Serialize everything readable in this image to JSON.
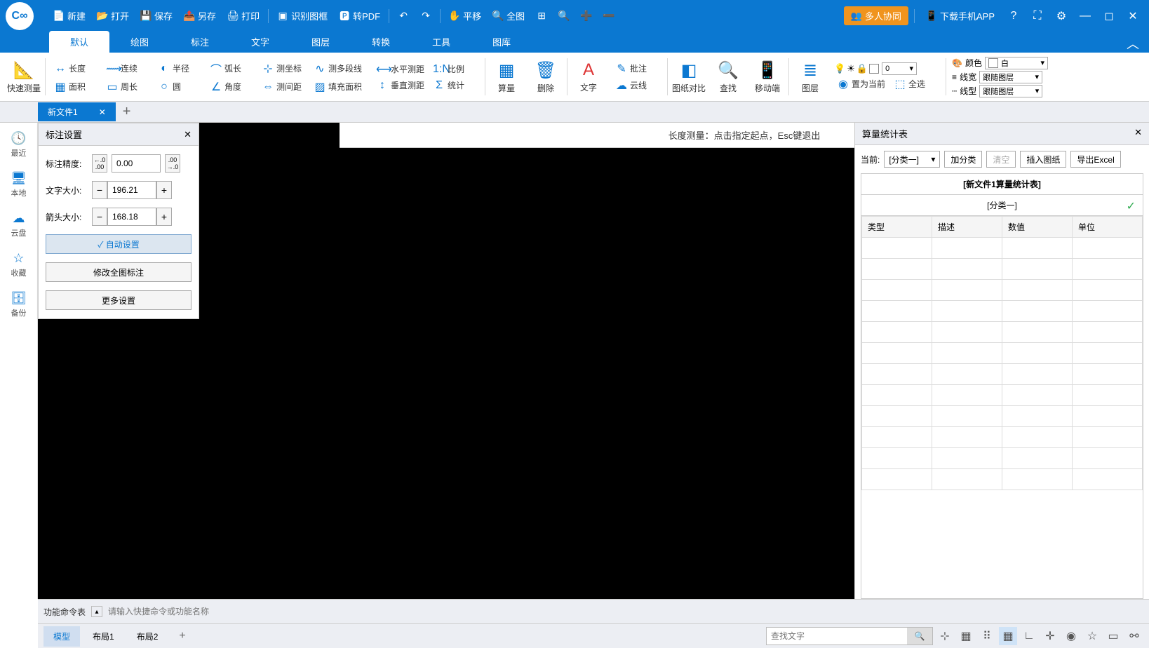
{
  "titlebar": {
    "new": "新建",
    "open": "打开",
    "save": "保存",
    "saveas": "另存",
    "print": "打印",
    "recognize": "识别图框",
    "topdf": "转PDF",
    "pan": "平移",
    "fullview": "全图",
    "collab": "多人协同",
    "download": "下载手机APP"
  },
  "menutabs": [
    "默认",
    "绘图",
    "标注",
    "文字",
    "图层",
    "转换",
    "工具",
    "图库"
  ],
  "ribbon": {
    "quick": "快速测量",
    "g1": {
      "len": "长度",
      "cont": "连续",
      "radius": "半径",
      "arc": "弧长",
      "coord": "测坐标",
      "multi": "测多段线",
      "area": "面积",
      "peri": "周长",
      "circle": "圆",
      "angle": "角度",
      "gap": "测间距",
      "fill": "填充面积"
    },
    "g2": {
      "horiz": "水平测距",
      "ratio": "比例",
      "vert": "垂直测距",
      "stat": "统计"
    },
    "g3": {
      "calc": "算量",
      "del": "删除"
    },
    "g4": {
      "text": "文字",
      "batch": "批注",
      "cloud": "云线"
    },
    "g5": {
      "compare": "图纸对比",
      "find": "查找",
      "mobile": "移动端"
    },
    "g6": {
      "layer": "图层",
      "setcur": "置为当前",
      "selall": "全选"
    },
    "props": {
      "color": "颜色",
      "colorval": "白",
      "lwidth": "线宽",
      "lwidthval": "跟随图层",
      "ltype": "线型",
      "ltypeval": "跟随图层"
    },
    "layerbox": "0"
  },
  "doctab": {
    "name": "新文件1"
  },
  "leftrail": [
    {
      "label": "最近",
      "icon": "🕓"
    },
    {
      "label": "本地",
      "icon": "🖥"
    },
    {
      "label": "云盘",
      "icon": "☁"
    },
    {
      "label": "收藏",
      "icon": "☆"
    },
    {
      "label": "备份",
      "icon": "🗄"
    }
  ],
  "hint": "长度测量：点击指定起点，Esc键退出",
  "anno": {
    "title": "标注设置",
    "precision": "标注精度:",
    "precval": "0.00",
    "textsize": "文字大小:",
    "textval": "196.21",
    "arrowsize": "箭头大小:",
    "arrowval": "168.18",
    "auto": "自动设置",
    "modall": "修改全图标注",
    "more": "更多设置"
  },
  "stats": {
    "title": "算量统计表",
    "current": "当前:",
    "cat": "[分类一]",
    "addcat": "加分类",
    "clear": "清空",
    "insert": "插入图纸",
    "export": "导出Excel",
    "tbltitle": "[新文件1算量统计表]",
    "catrow": "[分类一]",
    "cols": [
      "类型",
      "描述",
      "数值",
      "单位"
    ]
  },
  "cmdbar": {
    "label": "功能命令表",
    "placeholder": "请输入快捷命令或功能名称"
  },
  "status": {
    "layouts": [
      "模型",
      "布局1",
      "布局2"
    ],
    "searchph": "查找文字"
  }
}
